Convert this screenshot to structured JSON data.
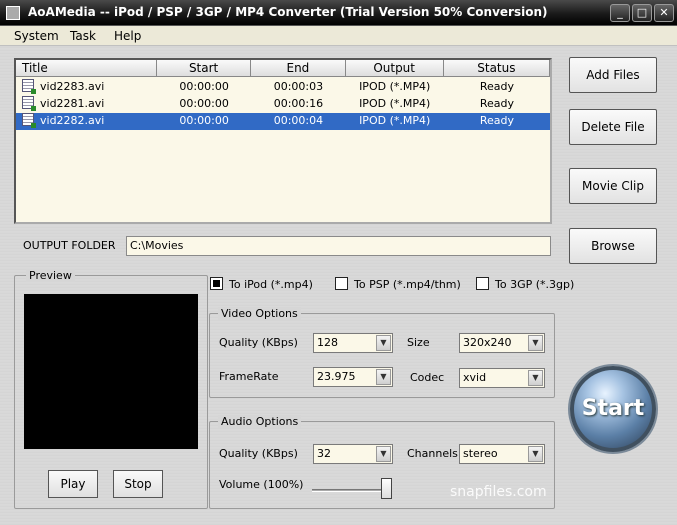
{
  "window": {
    "title": "AoAMedia -- iPod / PSP / 3GP / MP4 Converter (Trial Version 50% Conversion)",
    "minimize": "_",
    "maximize": "□",
    "close": "✕"
  },
  "menu": [
    "System",
    "Task",
    "Help"
  ],
  "file_table": {
    "columns": [
      "Title",
      "Start",
      "End",
      "Output",
      "Status"
    ],
    "rows": [
      {
        "title": "vid2283.avi",
        "start": "00:00:00",
        "end": "00:00:03",
        "output": "IPOD (*.MP4)",
        "status": "Ready"
      },
      {
        "title": "vid2281.avi",
        "start": "00:00:00",
        "end": "00:00:16",
        "output": "IPOD (*.MP4)",
        "status": "Ready"
      },
      {
        "title": "vid2282.avi",
        "start": "00:00:00",
        "end": "00:00:04",
        "output": "IPOD (*.MP4)",
        "status": "Ready"
      }
    ],
    "selected_row": 2
  },
  "buttons": {
    "add_files": "Add Files",
    "delete_file": "Delete File",
    "movie_clip": "Movie Clip",
    "browse": "Browse",
    "play": "Play",
    "stop": "Stop",
    "start": "Start"
  },
  "output_folder": {
    "label": "OUTPUT FOLDER",
    "value": "C:\\Movies"
  },
  "preview": {
    "label": "Preview"
  },
  "targets": [
    {
      "label": "To iPod (*.mp4)",
      "checked": true
    },
    {
      "label": "To PSP (*.mp4/thm)",
      "checked": false
    },
    {
      "label": "To 3GP (*.3gp)",
      "checked": false
    }
  ],
  "video_options": {
    "label": "Video Options",
    "quality_label": "Quality (KBps)",
    "quality": "128",
    "size_label": "Size",
    "size": "320x240",
    "framerate_label": "FrameRate",
    "framerate": "23.975",
    "codec_label": "Codec",
    "codec": "xvid"
  },
  "audio_options": {
    "label": "Audio Options",
    "quality_label": "Quality (KBps)",
    "quality": "32",
    "channels_label": "Channels",
    "channels": "stereo",
    "volume_label": "Volume (100%)",
    "volume": 1.0
  },
  "watermark": "snapfiles.com"
}
